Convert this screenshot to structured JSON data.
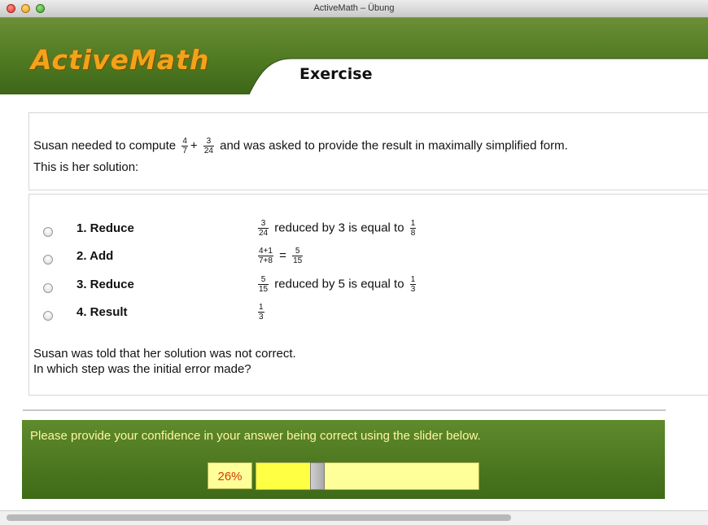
{
  "window": {
    "title": "ActiveMath – Übung"
  },
  "header": {
    "logo": "ActiveMath",
    "page_title": "Exercise"
  },
  "question": {
    "prefix": "Susan needed to compute",
    "frac_a": {
      "num": "4",
      "den": "7"
    },
    "plus": "+",
    "frac_b": {
      "num": "3",
      "den": "24"
    },
    "suffix": "and was asked to provide the result in maximally simplified form.",
    "line2": "This is her solution:"
  },
  "steps": [
    {
      "label": "1. Reduce",
      "f1": {
        "num": "3",
        "den": "24"
      },
      "text": "reduced by 3 is equal to",
      "f2": {
        "num": "1",
        "den": "8"
      }
    },
    {
      "label": "2. Add",
      "f1": {
        "num": "4+1",
        "den": "7+8"
      },
      "text": "=",
      "f2": {
        "num": "5",
        "den": "15"
      }
    },
    {
      "label": "3. Reduce",
      "f1": {
        "num": "5",
        "den": "15"
      },
      "text": "reduced by 5 is equal to",
      "f2": {
        "num": "1",
        "den": "3"
      }
    },
    {
      "label": "4. Result",
      "f1": {
        "num": "1",
        "den": "3"
      }
    }
  ],
  "followup": {
    "line1": "Susan was told that her solution was not correct.",
    "line2": "In which step was the initial error made?"
  },
  "confidence": {
    "prompt": "Please provide your confidence in your answer being correct using the slider below.",
    "value_label": "26%",
    "value": 0.26
  },
  "colors": {
    "header_green": "#4f7a22",
    "logo_orange": "#f2a31a",
    "prompt_yellow": "#fff6a0",
    "percent_red": "#d13a00"
  }
}
